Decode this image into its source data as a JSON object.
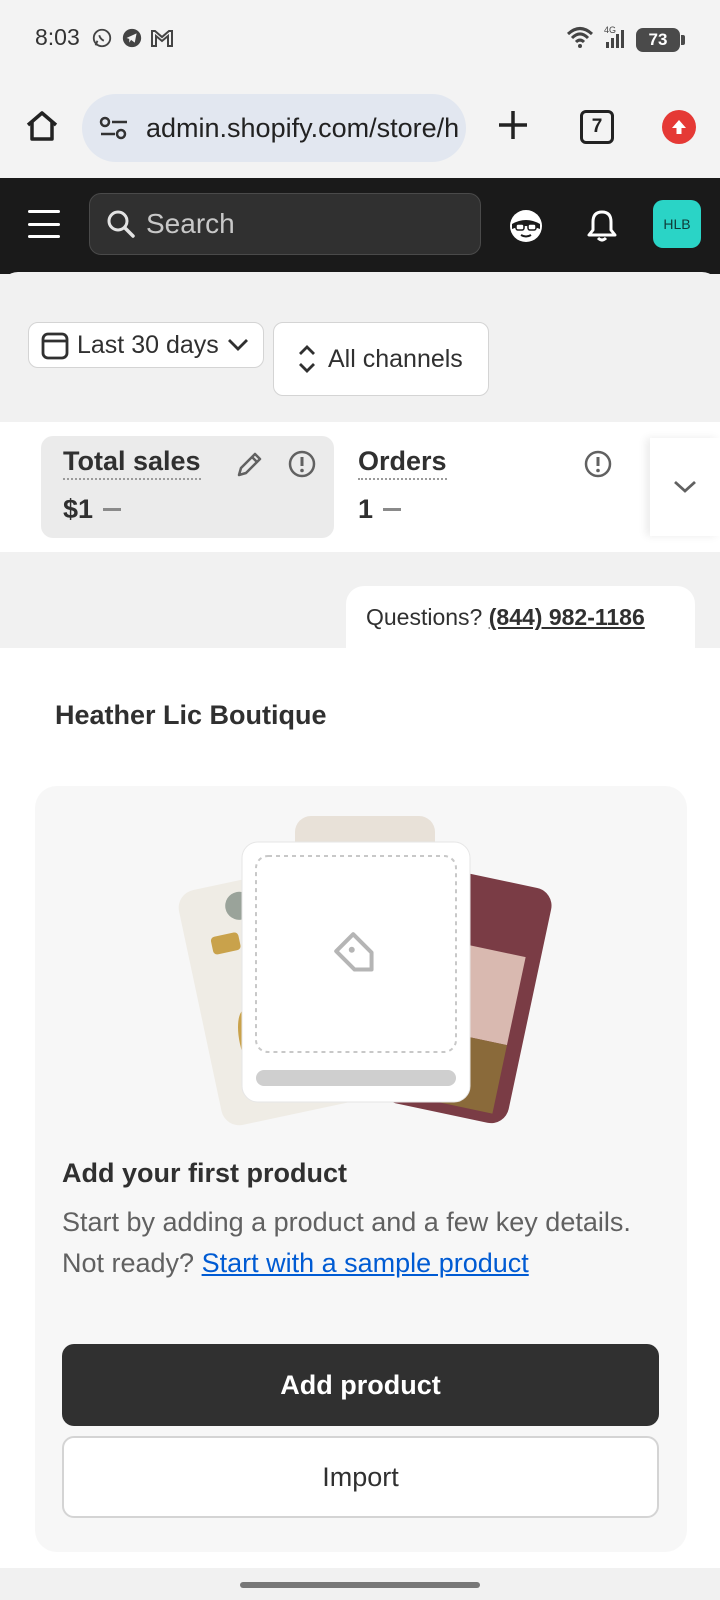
{
  "status_bar": {
    "time": "8:03",
    "apps": [
      "whatsapp-icon",
      "telegram-icon",
      "gmail-icon"
    ],
    "network": "4G",
    "battery": "73"
  },
  "browser": {
    "url": "admin.shopify.com/store/h",
    "tab_count": "7"
  },
  "header": {
    "search_placeholder": "Search",
    "avatar_initials": "HLB"
  },
  "filters": {
    "date_range": "Last 30 days",
    "channels": "All channels"
  },
  "metrics": [
    {
      "label": "Total sales",
      "value": "$1"
    },
    {
      "label": "Orders",
      "value": "1"
    }
  ],
  "support": {
    "prefix": "Questions?",
    "phone": "(844) 982-1186"
  },
  "store": {
    "name": "Heather Lic Boutique"
  },
  "onboarding": {
    "title": "Add your first product",
    "description": "Start by adding a product and a few key details. Not ready?",
    "sample_link": "Start with a sample product",
    "primary_button": "Add product",
    "secondary_button": "Import"
  }
}
